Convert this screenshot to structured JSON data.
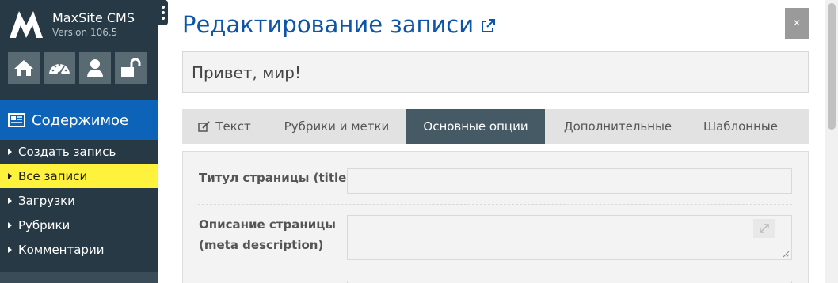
{
  "app": {
    "name": "MaxSite CMS",
    "version": "Version 106.5"
  },
  "quick_links": [
    {
      "icon": "home-icon"
    },
    {
      "icon": "dashboard-icon"
    },
    {
      "icon": "user-icon"
    },
    {
      "icon": "unlock-icon"
    }
  ],
  "sidebar": {
    "section_title": "Содержимое",
    "items": [
      {
        "label": "Создать запись",
        "active": false
      },
      {
        "label": "Все записи",
        "active": true
      },
      {
        "label": "Загрузки",
        "active": false
      },
      {
        "label": "Рубрики",
        "active": false
      },
      {
        "label": "Комментарии",
        "active": false
      }
    ]
  },
  "page": {
    "title": "Редактирование записи",
    "close_label": "×",
    "post_title_value": "Привет, мир!"
  },
  "tabs": [
    {
      "label": "Текст",
      "active": false
    },
    {
      "label": "Рубрики и метки",
      "active": false
    },
    {
      "label": "Основные опции",
      "active": true
    },
    {
      "label": "Дополнительные",
      "active": false
    },
    {
      "label": "Шаблонные",
      "active": false
    }
  ],
  "fields": {
    "title_label": "Титул страницы (title)",
    "title_value": "",
    "description_label_1": "Описание страницы",
    "description_label_2": "(meta description)",
    "description_value": ""
  },
  "colors": {
    "sidebar_bg": "#263944",
    "section_blue": "#0d63b8",
    "active_item": "#fff23d",
    "title_blue": "#0d55a8",
    "active_tab": "#455a64"
  }
}
